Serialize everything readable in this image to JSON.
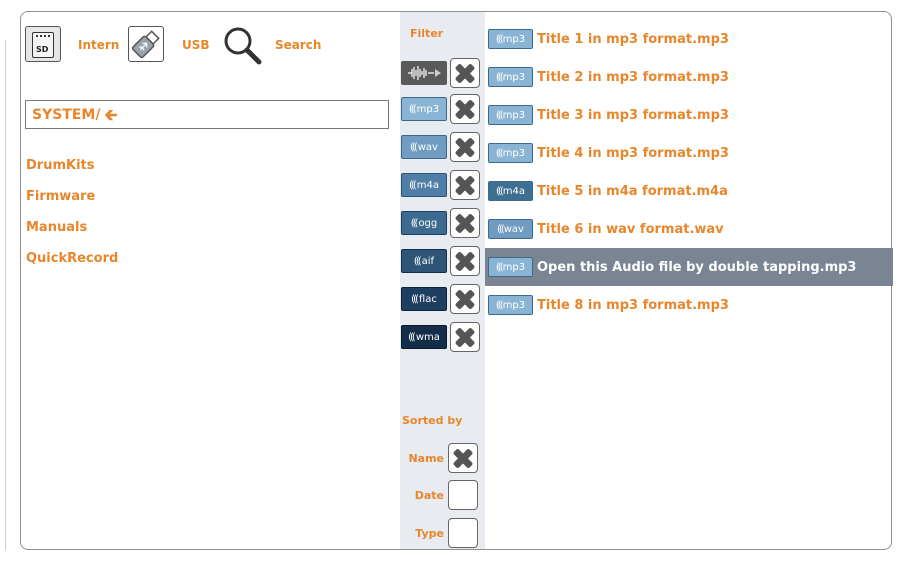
{
  "sources": {
    "sd_text": "SD",
    "intern_label": "Intern",
    "usb_label": "USB",
    "search_label": "Search"
  },
  "path": "SYSTEM/",
  "folders": [
    "DrumKits",
    "Firmware",
    "Manuals",
    "QuickRecord"
  ],
  "filter": {
    "title": "Filter",
    "formats": [
      {
        "label": "",
        "icon": "waveform-icon",
        "color": "#5a5a5a",
        "checked": true
      },
      {
        "label": "mp3",
        "color": "#8ab4d4",
        "checked": true
      },
      {
        "label": "wav",
        "color": "#6f9cc0",
        "checked": true
      },
      {
        "label": "m4a",
        "color": "#4f7fa6",
        "checked": true
      },
      {
        "label": "ogg",
        "color": "#3d6a90",
        "checked": true
      },
      {
        "label": "aif",
        "color": "#2d5578",
        "checked": true
      },
      {
        "label": "flac",
        "color": "#1f3f60",
        "checked": true
      },
      {
        "label": "wma",
        "color": "#142e4a",
        "checked": true
      }
    ]
  },
  "sort": {
    "title": "Sorted by",
    "options": [
      {
        "label": "Name",
        "checked": true
      },
      {
        "label": "Date",
        "checked": false
      },
      {
        "label": "Type",
        "checked": false
      }
    ]
  },
  "files": [
    {
      "badge": "mp3",
      "name": "Title 1 in mp3 format.mp3",
      "selected": false
    },
    {
      "badge": "mp3",
      "name": "Title 2 in mp3 format.mp3",
      "selected": false
    },
    {
      "badge": "mp3",
      "name": "Title 3 in mp3 format.mp3",
      "selected": false
    },
    {
      "badge": "mp3",
      "name": "Title 4 in mp3 format.mp3",
      "selected": false
    },
    {
      "badge": "m4a",
      "name": "Title 5 in m4a format.m4a",
      "selected": false
    },
    {
      "badge": "wav",
      "name": "Title 6 in wav format.wav",
      "selected": false
    },
    {
      "badge": "mp3",
      "name": "Open this Audio file by double tapping.mp3",
      "selected": true
    },
    {
      "badge": "mp3",
      "name": "Title 8 in mp3 format.mp3",
      "selected": false
    }
  ],
  "colors": {
    "accent": "#e8862b",
    "selected_row": "#7a8493",
    "filter_bg": "#e8ebef"
  }
}
